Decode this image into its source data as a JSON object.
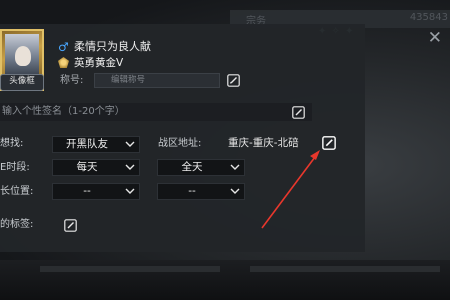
{
  "background": {
    "top_tab_left": "宗务",
    "top_tab_right": "435843",
    "close_symbol": "✕"
  },
  "profile": {
    "avatar_caption": "头像框",
    "gender_symbol": "♂",
    "nickname": "柔情只为良人献",
    "rank": "英勇黄金Ⅴ",
    "title_label": "称号:",
    "title_placeholder": "编辑称号"
  },
  "signature": {
    "placeholder": "输入个性签名（1-20个字）"
  },
  "fields": {
    "find_label": "想找:",
    "find_value": "开黑队友",
    "zone_label": "战区地址:",
    "zone_value": "重庆-重庆-北碚",
    "time_label": "E时段:",
    "time_day_value": "每天",
    "time_range_value": "全天",
    "position_label": "长位置:",
    "position_value_1": "--",
    "position_value_2": "--",
    "tags_label": "的标签:"
  },
  "colors": {
    "annotation_arrow": "#e8372c",
    "gender_blue": "#4aa7ff"
  }
}
